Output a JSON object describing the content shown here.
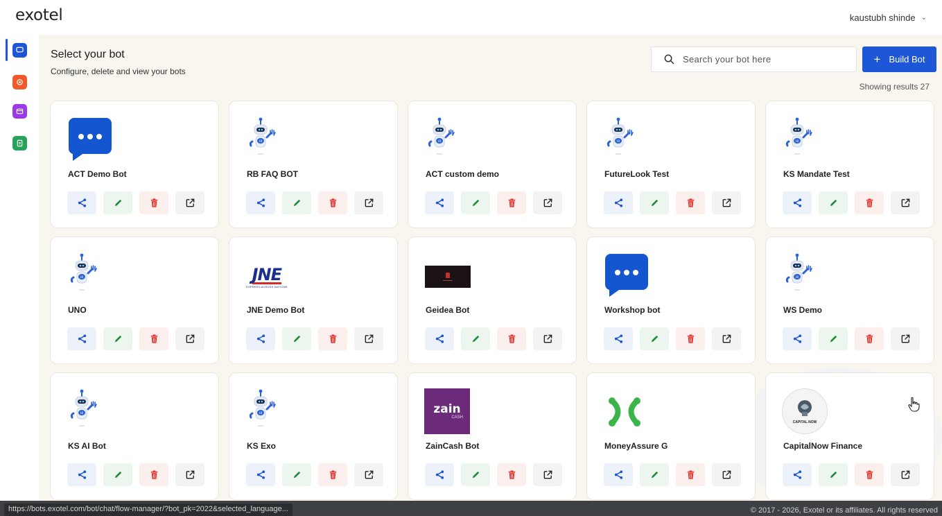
{
  "header": {
    "logo": "exotel",
    "user_name": "kaustubh shinde"
  },
  "sidebar": {
    "items": [
      {
        "icon": "chat-bubble-icon",
        "color": "#1e55d4",
        "active": true
      },
      {
        "icon": "record-icon",
        "color": "#f05a28",
        "active": false
      },
      {
        "icon": "message-card-icon",
        "color": "#9b3be8",
        "active": false
      },
      {
        "icon": "document-icon",
        "color": "#27a35a",
        "active": false
      }
    ]
  },
  "page": {
    "title": "Select your bot",
    "subtitle": "Configure, delete and view your bots",
    "search_placeholder": "Search your bot here",
    "build_button": "Build Bot",
    "results_text": "Showing results 27"
  },
  "bots": [
    {
      "name": "ACT Demo Bot",
      "logo": "chat-bubble-logo"
    },
    {
      "name": "RB FAQ BOT",
      "logo": "robot-logo"
    },
    {
      "name": "ACT custom demo",
      "logo": "robot-logo"
    },
    {
      "name": "FutureLook Test",
      "logo": "robot-logo"
    },
    {
      "name": "KS Mandate Test",
      "logo": "robot-logo"
    },
    {
      "name": "UNO",
      "logo": "robot-logo"
    },
    {
      "name": "JNE Demo Bot",
      "logo": "jne-logo"
    },
    {
      "name": "Geidea Bot",
      "logo": "geidea-logo"
    },
    {
      "name": "Workshop bot",
      "logo": "chat-bubble-logo"
    },
    {
      "name": "WS Demo",
      "logo": "robot-logo"
    },
    {
      "name": "KS AI Bot",
      "logo": "robot-logo"
    },
    {
      "name": "KS Exo",
      "logo": "robot-logo"
    },
    {
      "name": "ZainCash Bot",
      "logo": "zaincash-logo"
    },
    {
      "name": "MoneyAssure G",
      "logo": "moneyassure-logo"
    },
    {
      "name": "CapitalNow Finance",
      "logo": "capitalnow-logo"
    }
  ],
  "logo_text": {
    "jne": "JNE",
    "jne_tagline": "EXPRESS ACROSS NATIONS",
    "zain": "zain",
    "zain_sub": "CASH",
    "capitalnow": "CAPITAL NOW"
  },
  "status_bar": {
    "url": "https://bots.exotel.com/bot/chat/flow-manager/?bot_pk=2022&selected_language...",
    "copyright": "© 2017 - 2026, Exotel or its affiliates. All rights reserved"
  },
  "colors": {
    "primary": "#1d57d8",
    "share": "#1e55d4",
    "edit": "#1f8a3a",
    "delete": "#e8322b",
    "background": "#f8f6ef"
  }
}
